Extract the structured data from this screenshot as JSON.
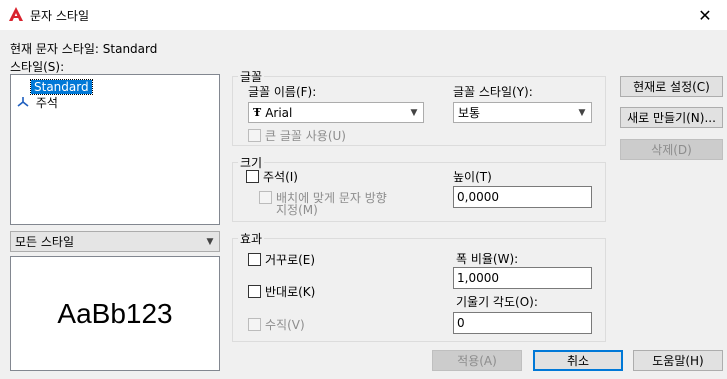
{
  "window": {
    "title": "문자 스타일",
    "close_glyph": "✕"
  },
  "current_style_label": "현재 문자 스타일:  Standard",
  "styles_label": "스타일(S):",
  "styles": [
    {
      "name": "Standard",
      "selected": true
    },
    {
      "name": "주석",
      "selected": false
    }
  ],
  "filter_combo": {
    "value": "모든 스타일"
  },
  "preview_text": "AaBb123",
  "font": {
    "group_title": "글꼴",
    "name_label": "글꼴 이름(F):",
    "name_value": "Arial",
    "style_label": "글꼴 스타일(Y):",
    "style_value": "보통",
    "big_font_label": "큰 글꼴 사용(U)"
  },
  "size": {
    "group_title": "크기",
    "annotative_label": "주석(I)",
    "match_orientation_label_1": "배치에 맞게 문자 방향",
    "match_orientation_label_2": "지정(M)",
    "height_label": "높이(T)",
    "height_value": "0,0000"
  },
  "effects": {
    "group_title": "효과",
    "upside_down_label": "거꾸로(E)",
    "backwards_label": "반대로(K)",
    "vertical_label": "수직(V)",
    "width_factor_label": "폭 비율(W):",
    "width_factor_value": "1,0000",
    "oblique_label": "기울기 각도(O):",
    "oblique_value": "0"
  },
  "buttons": {
    "set_current": "현재로 설정(C)",
    "new": "새로 만들기(N)...",
    "delete": "삭제(D)",
    "apply": "적용(A)",
    "cancel": "취소",
    "help": "도움말(H)"
  },
  "colors": {
    "accent": "#0078d7",
    "autocad_red": "#d9232e"
  }
}
